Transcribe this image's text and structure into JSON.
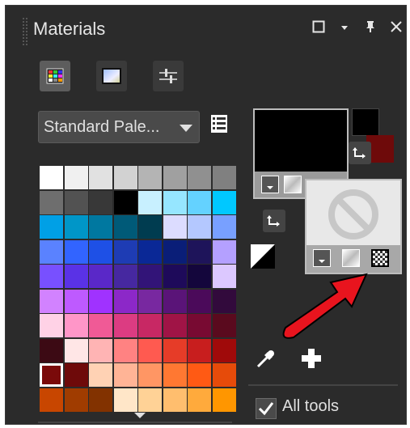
{
  "panel": {
    "title": "Materials",
    "title_buttons": [
      "maximize-icon",
      "dropdown-icon",
      "pin-icon",
      "close-icon"
    ],
    "tabs": [
      {
        "name": "swatches-tab",
        "icon": "palette-grid-icon",
        "active": true
      },
      {
        "name": "rainbow-tab",
        "icon": "color-frame-icon",
        "active": false
      },
      {
        "name": "sliders-tab",
        "icon": "sliders-icon",
        "active": false
      }
    ],
    "palette_select": {
      "value": "Standard Pale..."
    },
    "palette_colors": [
      [
        "#ffffff",
        "#f0f0f0",
        "#e1e1e1",
        "#d2d2d2",
        "#b4b4b4",
        "#a0a0a0",
        "#909090",
        "#808080"
      ],
      [
        "#6e6e6e",
        "#525252",
        "#383838",
        "#000000",
        "#c8f0ff",
        "#96e6ff",
        "#64d2ff",
        "#00c8ff"
      ],
      [
        "#00a0e6",
        "#0096c8",
        "#0078a0",
        "#005a78",
        "#003c50",
        "#dcdcff",
        "#b4c8ff",
        "#78a0ff"
      ],
      [
        "#5a82ff",
        "#3264ff",
        "#1e50e6",
        "#1e3cb4",
        "#0a2896",
        "#0a1e78",
        "#1e145a",
        "#b4a0ff"
      ],
      [
        "#7850ff",
        "#5a32e6",
        "#5a28c8",
        "#4628a0",
        "#321478",
        "#1e0a5a",
        "#14063c",
        "#dcc8ff"
      ],
      [
        "#d282ff",
        "#be5aff",
        "#a032ff",
        "#8c28c8",
        "#7828a0",
        "#5a1478",
        "#4b0a5a",
        "#320a3c"
      ],
      [
        "#ffd2e6",
        "#ff96c8",
        "#f05a96",
        "#dc3c82",
        "#c82864",
        "#a01446",
        "#780a32",
        "#5a0a1e"
      ],
      [
        "#3c0a14",
        "#ffe6e6",
        "#ffb4b4",
        "#ff8282",
        "#ff5a50",
        "#e63c28",
        "#c81e1e",
        "#a00a0a"
      ],
      [
        "#7a0a0a",
        "#6e0a0a",
        "#ffd2b4",
        "#ffb496",
        "#ff9664",
        "#ff7832",
        "#ff5a14",
        "#e64b0a"
      ],
      [
        "#c84600",
        "#a03c00",
        "#823200",
        "#ffe6c8",
        "#ffd296",
        "#ffbe6e",
        "#ffaa3c",
        "#ff9600"
      ]
    ],
    "selected_swatch": {
      "row": 8,
      "col": 0
    },
    "foreground": {
      "color": "#000000",
      "small_color": "#000000"
    },
    "background": {
      "icon": "no-material-icon",
      "small_color": "#6e0a0a"
    },
    "all_tools_label": "All tools",
    "all_tools_checked": true,
    "annotation_arrow_color": "#e8141e"
  }
}
